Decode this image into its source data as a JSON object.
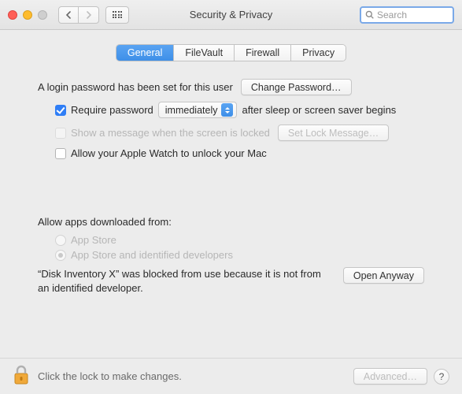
{
  "window": {
    "title": "Security & Privacy"
  },
  "search": {
    "placeholder": "Search"
  },
  "tabs": {
    "general": "General",
    "filevault": "FileVault",
    "firewall": "Firewall",
    "privacy": "Privacy"
  },
  "login": {
    "status": "A login password has been set for this user",
    "change_btn": "Change Password…",
    "require_label": "Require password",
    "require_delay": "immediately",
    "require_tail": "after sleep or screen saver begins",
    "show_message_label": "Show a message when the screen is locked",
    "set_lock_btn": "Set Lock Message…",
    "watch_label": "Allow your Apple Watch to unlock your Mac"
  },
  "download": {
    "heading": "Allow apps downloaded from:",
    "appstore": "App Store",
    "identified": "App Store and identified developers",
    "blocked_msg": "“Disk Inventory X” was blocked from use because it is not from an identified developer.",
    "open_anyway": "Open Anyway"
  },
  "footer": {
    "lock_text": "Click the lock to make changes.",
    "advanced": "Advanced…",
    "help": "?"
  }
}
